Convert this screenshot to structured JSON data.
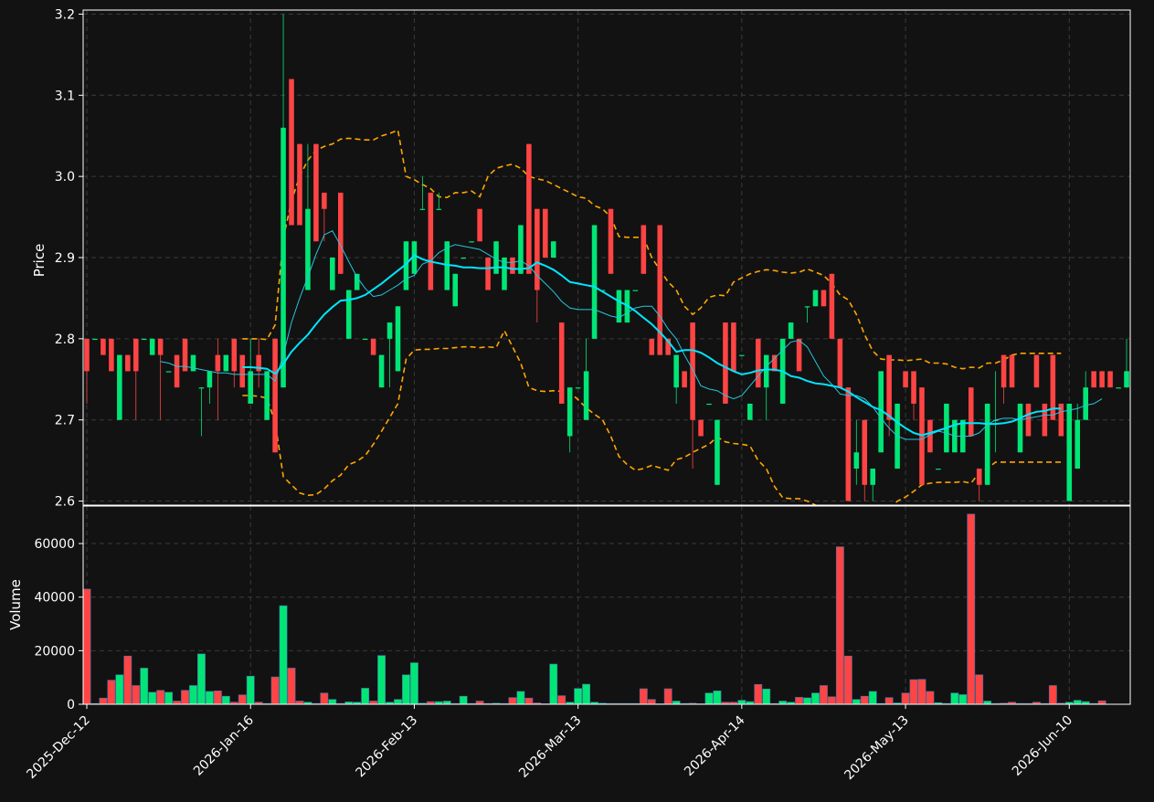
{
  "chart_data": {
    "type": "candlestick",
    "colors": {
      "background": "#121212",
      "up": "#00e676",
      "down": "#ff4444",
      "ma_fast": "#26c6da",
      "ma_slow": "#00e5ff",
      "bands": "#ffa500",
      "grid": "#3a3a3a",
      "text": "#ffffff"
    },
    "price_panel": {
      "ylabel": "Price",
      "ylim": [
        2.595,
        3.205
      ],
      "yticks": [
        "2.6",
        "2.7",
        "2.8",
        "2.9",
        "3.0",
        "3.1",
        "3.2"
      ],
      "grid": true
    },
    "volume_panel": {
      "ylabel": "Volume",
      "ylim": [
        0,
        74000
      ],
      "yticks": [
        "0",
        "20000",
        "40000",
        "60000"
      ],
      "grid": true
    },
    "x_ticks": [
      "2025-Dec-12",
      "2026-Jan-16",
      "2026-Feb-13",
      "2026-Mar-13",
      "2026-Apr-14",
      "2026-May-13",
      "2026-Jun-10"
    ],
    "x_tick_positions": [
      0,
      20,
      40,
      60,
      80,
      100,
      120
    ],
    "candles": [
      [
        2.8,
        2.8,
        2.72,
        2.76
      ],
      [
        2.8,
        2.8,
        2.8,
        2.8
      ],
      [
        2.8,
        2.8,
        2.78,
        2.78
      ],
      [
        2.8,
        2.8,
        2.76,
        2.76
      ],
      [
        2.7,
        2.78,
        2.7,
        2.78
      ],
      [
        2.78,
        2.78,
        2.76,
        2.76
      ],
      [
        2.8,
        2.8,
        2.7,
        2.76
      ],
      [
        2.8,
        2.8,
        2.8,
        2.8
      ],
      [
        2.78,
        2.8,
        2.78,
        2.8
      ],
      [
        2.8,
        2.8,
        2.7,
        2.78
      ],
      [
        2.76,
        2.76,
        2.76,
        2.76
      ],
      [
        2.78,
        2.78,
        2.74,
        2.74
      ],
      [
        2.8,
        2.8,
        2.76,
        2.76
      ],
      [
        2.76,
        2.78,
        2.76,
        2.78
      ],
      [
        2.74,
        2.74,
        2.68,
        2.74
      ],
      [
        2.74,
        2.76,
        2.72,
        2.76
      ],
      [
        2.78,
        2.8,
        2.7,
        2.76
      ],
      [
        2.76,
        2.78,
        2.76,
        2.78
      ],
      [
        2.8,
        2.8,
        2.74,
        2.76
      ],
      [
        2.78,
        2.78,
        2.74,
        2.74
      ],
      [
        2.72,
        2.8,
        2.72,
        2.76
      ],
      [
        2.78,
        2.8,
        2.74,
        2.76
      ],
      [
        2.7,
        2.76,
        2.7,
        2.76
      ],
      [
        2.8,
        2.8,
        2.66,
        2.66
      ],
      [
        2.74,
        3.2,
        2.74,
        3.06
      ],
      [
        3.12,
        3.12,
        2.94,
        2.94
      ],
      [
        3.04,
        3.04,
        2.94,
        2.94
      ],
      [
        2.86,
        3.04,
        2.86,
        2.96
      ],
      [
        3.04,
        3.04,
        2.92,
        2.92
      ],
      [
        2.98,
        2.98,
        2.92,
        2.96
      ],
      [
        2.86,
        2.9,
        2.86,
        2.9
      ],
      [
        2.98,
        2.98,
        2.88,
        2.88
      ],
      [
        2.8,
        2.86,
        2.8,
        2.86
      ],
      [
        2.86,
        2.88,
        2.86,
        2.88
      ],
      [
        2.8,
        2.8,
        2.8,
        2.8
      ],
      [
        2.8,
        2.8,
        2.78,
        2.78
      ],
      [
        2.74,
        2.78,
        2.74,
        2.78
      ],
      [
        2.8,
        2.82,
        2.74,
        2.82
      ],
      [
        2.76,
        2.84,
        2.76,
        2.84
      ],
      [
        2.86,
        2.92,
        2.86,
        2.92
      ],
      [
        2.88,
        2.92,
        2.88,
        2.92
      ],
      [
        2.96,
        3.0,
        2.96,
        2.96
      ],
      [
        2.98,
        2.98,
        2.86,
        2.86
      ],
      [
        2.96,
        2.98,
        2.96,
        2.96
      ],
      [
        2.86,
        2.92,
        2.86,
        2.92
      ],
      [
        2.84,
        2.88,
        2.84,
        2.88
      ],
      [
        2.9,
        2.9,
        2.9,
        2.9
      ],
      [
        2.92,
        2.92,
        2.92,
        2.92
      ],
      [
        2.96,
        2.96,
        2.92,
        2.92
      ],
      [
        2.9,
        2.9,
        2.86,
        2.86
      ],
      [
        2.88,
        2.92,
        2.88,
        2.92
      ],
      [
        2.86,
        2.9,
        2.86,
        2.9
      ],
      [
        2.9,
        2.9,
        2.88,
        2.88
      ],
      [
        2.88,
        2.94,
        2.88,
        2.94
      ],
      [
        3.04,
        3.04,
        2.88,
        2.88
      ],
      [
        2.96,
        2.96,
        2.82,
        2.86
      ],
      [
        2.96,
        2.96,
        2.9,
        2.9
      ],
      [
        2.9,
        2.92,
        2.9,
        2.92
      ],
      [
        2.82,
        2.82,
        2.72,
        2.72
      ],
      [
        2.68,
        2.74,
        2.66,
        2.74
      ],
      [
        2.74,
        2.74,
        2.74,
        2.74
      ],
      [
        2.7,
        2.8,
        2.7,
        2.76
      ],
      [
        2.8,
        2.94,
        2.8,
        2.94
      ],
      [
        2.86,
        2.86,
        2.86,
        2.86
      ],
      [
        2.96,
        2.96,
        2.88,
        2.88
      ],
      [
        2.82,
        2.86,
        2.82,
        2.86
      ],
      [
        2.82,
        2.86,
        2.82,
        2.86
      ],
      [
        2.86,
        2.86,
        2.86,
        2.86
      ],
      [
        2.94,
        2.94,
        2.88,
        2.88
      ],
      [
        2.8,
        2.8,
        2.78,
        2.78
      ],
      [
        2.94,
        2.94,
        2.78,
        2.78
      ],
      [
        2.8,
        2.8,
        2.78,
        2.78
      ],
      [
        2.74,
        2.78,
        2.72,
        2.78
      ],
      [
        2.76,
        2.76,
        2.74,
        2.74
      ],
      [
        2.82,
        2.82,
        2.64,
        2.7
      ],
      [
        2.7,
        2.7,
        2.68,
        2.68
      ],
      [
        2.72,
        2.72,
        2.72,
        2.72
      ],
      [
        2.62,
        2.7,
        2.62,
        2.7
      ],
      [
        2.82,
        2.82,
        2.72,
        2.72
      ],
      [
        2.82,
        2.82,
        2.76,
        2.76
      ],
      [
        2.78,
        2.78,
        2.78,
        2.78
      ],
      [
        2.7,
        2.72,
        2.7,
        2.72
      ],
      [
        2.8,
        2.8,
        2.74,
        2.74
      ],
      [
        2.74,
        2.78,
        2.7,
        2.78
      ],
      [
        2.78,
        2.78,
        2.76,
        2.76
      ],
      [
        2.72,
        2.8,
        2.72,
        2.8
      ],
      [
        2.8,
        2.82,
        2.8,
        2.82
      ],
      [
        2.8,
        2.8,
        2.76,
        2.76
      ],
      [
        2.84,
        2.84,
        2.82,
        2.84
      ],
      [
        2.84,
        2.86,
        2.84,
        2.86
      ],
      [
        2.86,
        2.86,
        2.84,
        2.84
      ],
      [
        2.88,
        2.88,
        2.8,
        2.8
      ],
      [
        2.8,
        2.8,
        2.74,
        2.74
      ],
      [
        2.74,
        2.74,
        2.6,
        2.6
      ],
      [
        2.64,
        2.7,
        2.62,
        2.66
      ],
      [
        2.7,
        2.7,
        2.6,
        2.62
      ],
      [
        2.62,
        2.64,
        2.6,
        2.64
      ],
      [
        2.66,
        2.76,
        2.66,
        2.76
      ],
      [
        2.78,
        2.78,
        2.68,
        2.7
      ],
      [
        2.64,
        2.72,
        2.64,
        2.72
      ],
      [
        2.76,
        2.76,
        2.74,
        2.74
      ],
      [
        2.76,
        2.76,
        2.7,
        2.72
      ],
      [
        2.74,
        2.74,
        2.62,
        2.62
      ],
      [
        2.7,
        2.7,
        2.66,
        2.66
      ],
      [
        2.64,
        2.64,
        2.64,
        2.64
      ],
      [
        2.66,
        2.72,
        2.66,
        2.72
      ],
      [
        2.66,
        2.7,
        2.66,
        2.7
      ],
      [
        2.66,
        2.7,
        2.66,
        2.7
      ],
      [
        2.74,
        2.74,
        2.68,
        2.68
      ],
      [
        2.64,
        2.64,
        2.6,
        2.62
      ],
      [
        2.62,
        2.72,
        2.62,
        2.72
      ],
      [
        2.7,
        2.76,
        2.66,
        2.7
      ],
      [
        2.78,
        2.78,
        2.72,
        2.74
      ],
      [
        2.78,
        2.78,
        2.74,
        2.74
      ],
      [
        2.66,
        2.72,
        2.66,
        2.72
      ],
      [
        2.72,
        2.72,
        2.68,
        2.68
      ],
      [
        2.78,
        2.78,
        2.74,
        2.74
      ],
      [
        2.72,
        2.72,
        2.68,
        2.68
      ],
      [
        2.78,
        2.78,
        2.7,
        2.7
      ],
      [
        2.72,
        2.72,
        2.68,
        2.68
      ],
      [
        2.6,
        2.72,
        2.6,
        2.72
      ],
      [
        2.64,
        2.72,
        2.64,
        2.7
      ],
      [
        2.7,
        2.76,
        2.7,
        2.74
      ],
      [
        2.76,
        2.76,
        2.74,
        2.74
      ],
      [
        2.76,
        2.76,
        2.74,
        2.74
      ],
      [
        2.76,
        2.76,
        2.74,
        2.74
      ],
      [
        2.74,
        2.74,
        2.74,
        2.74
      ],
      [
        2.74,
        2.8,
        2.74,
        2.76
      ]
    ],
    "volume": [
      43000,
      300,
      2300,
      9000,
      11000,
      18000,
      7000,
      13500,
      4500,
      5200,
      4500,
      1200,
      5200,
      7000,
      18800,
      4800,
      5000,
      3000,
      800,
      3500,
      10500,
      800,
      300,
      10200,
      36800,
      13500,
      1200,
      800,
      300,
      4200,
      1800,
      300,
      900,
      800,
      6000,
      1200,
      18200,
      800,
      1800,
      11000,
      15500,
      400,
      1000,
      1000,
      1200,
      300,
      3000,
      300,
      1200,
      300,
      400,
      300,
      2500,
      4800,
      2300,
      500,
      200,
      15000,
      3200,
      800,
      5900,
      7500,
      800,
      400,
      300,
      300,
      300,
      300,
      5800,
      1800,
      200,
      5800,
      1200,
      300,
      400,
      200,
      4200,
      5000,
      800,
      800,
      1500,
      1000,
      7400,
      5700,
      300,
      1200,
      800,
      2600,
      2400,
      4200,
      7000,
      2800,
      58800,
      18000,
      1800,
      3000,
      4800,
      300,
      2500,
      500,
      4200,
      9200,
      9300,
      4800,
      600,
      300,
      4200,
      3600,
      71000,
      11000,
      1200,
      300,
      400,
      800,
      300,
      300,
      800,
      300,
      7000,
      400,
      800,
      1500,
      1000,
      300,
      1300
    ],
    "ma_fast": [
      null,
      null,
      null,
      null,
      null,
      null,
      null,
      null,
      null,
      2.772,
      2.77,
      2.766,
      2.766,
      2.764,
      2.762,
      2.76,
      2.758,
      2.758,
      2.756,
      2.756,
      2.756,
      2.756,
      2.756,
      2.748,
      2.78,
      2.82,
      2.85,
      2.876,
      2.904,
      2.928,
      2.933,
      2.915,
      2.895,
      2.876,
      2.862,
      2.852,
      2.854,
      2.86,
      2.866,
      2.874,
      2.878,
      2.892,
      2.896,
      2.906,
      2.912,
      2.916,
      2.914,
      2.912,
      2.91,
      2.904,
      2.898,
      2.894,
      2.894,
      2.896,
      2.89,
      2.878,
      2.868,
      2.858,
      2.846,
      2.838,
      2.836,
      2.836,
      2.836,
      2.832,
      2.828,
      2.826,
      2.832,
      2.838,
      2.84,
      2.84,
      2.828,
      2.812,
      2.8,
      2.78,
      2.762,
      2.742,
      2.738,
      2.736,
      2.73,
      2.726,
      2.73,
      2.742,
      2.754,
      2.766,
      2.776,
      2.786,
      2.796,
      2.798,
      2.79,
      2.772,
      2.754,
      2.744,
      2.732,
      2.73,
      2.73,
      2.726,
      2.716,
      2.702,
      2.69,
      2.68,
      2.676,
      2.676,
      2.676,
      2.682,
      2.686,
      2.684,
      2.68,
      2.68,
      2.68,
      2.684,
      2.694,
      2.7,
      2.702,
      2.702,
      2.7,
      2.702,
      2.704,
      2.706,
      2.706,
      2.71,
      2.712,
      2.714,
      2.718,
      2.72,
      2.726
    ],
    "ma_slow": [
      null,
      null,
      null,
      null,
      null,
      null,
      null,
      null,
      null,
      null,
      null,
      null,
      null,
      null,
      null,
      null,
      null,
      null,
      null,
      2.765,
      2.765,
      2.764,
      2.763,
      2.757,
      2.769,
      2.784,
      2.795,
      2.805,
      2.818,
      2.83,
      2.839,
      2.847,
      2.848,
      2.85,
      2.854,
      2.861,
      2.868,
      2.876,
      2.884,
      2.892,
      2.903,
      2.898,
      2.895,
      2.893,
      2.891,
      2.89,
      2.888,
      2.888,
      2.887,
      2.887,
      2.888,
      2.888,
      2.886,
      2.886,
      2.887,
      2.894,
      2.89,
      2.885,
      2.878,
      2.87,
      2.868,
      2.866,
      2.864,
      2.858,
      2.852,
      2.846,
      2.841,
      2.834,
      2.826,
      2.818,
      2.808,
      2.797,
      2.784,
      2.786,
      2.786,
      2.783,
      2.777,
      2.77,
      2.765,
      2.76,
      2.756,
      2.758,
      2.761,
      2.762,
      2.762,
      2.76,
      2.754,
      2.752,
      2.748,
      2.745,
      2.744,
      2.742,
      2.74,
      2.735,
      2.728,
      2.722,
      2.716,
      2.712,
      2.705,
      2.697,
      2.69,
      2.684,
      2.681,
      2.684,
      2.687,
      2.69,
      2.694,
      2.696,
      2.696,
      2.696,
      2.695,
      2.695,
      2.696,
      2.698,
      2.702,
      2.707,
      2.71,
      2.711,
      2.714,
      2.714
    ],
    "band_upper": [
      null,
      null,
      null,
      null,
      null,
      null,
      null,
      null,
      null,
      null,
      null,
      null,
      null,
      null,
      null,
      null,
      null,
      null,
      null,
      2.8,
      2.8,
      2.8,
      2.799,
      2.817,
      2.924,
      2.97,
      3.0,
      3.02,
      3.032,
      3.037,
      3.04,
      3.046,
      3.047,
      3.046,
      3.045,
      3.045,
      3.05,
      3.053,
      3.057,
      3.0,
      2.996,
      2.99,
      2.985,
      2.975,
      2.974,
      2.98,
      2.98,
      2.982,
      2.975,
      3.0,
      3.01,
      3.013,
      3.015,
      3.01,
      3.0,
      2.997,
      2.995,
      2.99,
      2.985,
      2.98,
      2.975,
      2.973,
      2.964,
      2.96,
      2.95,
      2.926,
      2.925,
      2.925,
      2.925,
      2.9,
      2.885,
      2.87,
      2.86,
      2.84,
      2.83,
      2.838,
      2.851,
      2.854,
      2.853,
      2.87,
      2.875,
      2.88,
      2.883,
      2.885,
      2.884,
      2.882,
      2.881,
      2.882,
      2.886,
      2.882,
      2.878,
      2.868,
      2.854,
      2.848,
      2.83,
      2.805,
      2.785,
      2.775,
      2.774,
      2.774,
      2.773,
      2.774,
      2.775,
      2.77,
      2.77,
      2.769,
      2.765,
      2.763,
      2.765,
      2.764,
      2.77,
      2.77,
      2.774,
      2.78,
      2.782,
      2.782,
      2.782,
      2.782,
      2.782,
      2.782
    ],
    "band_lower": [
      null,
      null,
      null,
      null,
      null,
      null,
      null,
      null,
      null,
      null,
      null,
      null,
      null,
      null,
      null,
      null,
      null,
      null,
      null,
      2.73,
      2.73,
      2.729,
      2.727,
      2.697,
      2.63,
      2.62,
      2.61,
      2.607,
      2.608,
      2.615,
      2.625,
      2.632,
      2.645,
      2.649,
      2.656,
      2.67,
      2.686,
      2.703,
      2.72,
      2.775,
      2.786,
      2.787,
      2.787,
      2.788,
      2.788,
      2.789,
      2.79,
      2.79,
      2.789,
      2.79,
      2.789,
      2.81,
      2.79,
      2.77,
      2.74,
      2.736,
      2.735,
      2.736,
      2.735,
      2.734,
      2.725,
      2.715,
      2.707,
      2.7,
      2.68,
      2.655,
      2.645,
      2.638,
      2.64,
      2.644,
      2.641,
      2.638,
      2.651,
      2.654,
      2.66,
      2.665,
      2.67,
      2.679,
      2.673,
      2.671,
      2.67,
      2.668,
      2.65,
      2.64,
      2.618,
      2.604,
      2.603,
      2.603,
      2.6,
      2.595,
      2.59,
      2.585,
      2.57,
      2.562,
      2.56,
      2.56,
      2.562,
      2.58,
      2.59,
      2.6,
      2.605,
      2.612,
      2.62,
      2.622,
      2.623,
      2.623,
      2.623,
      2.624,
      2.622,
      2.635,
      2.64,
      2.648,
      2.648,
      2.648,
      2.648,
      2.648,
      2.648,
      2.648,
      2.648,
      2.648
    ]
  }
}
